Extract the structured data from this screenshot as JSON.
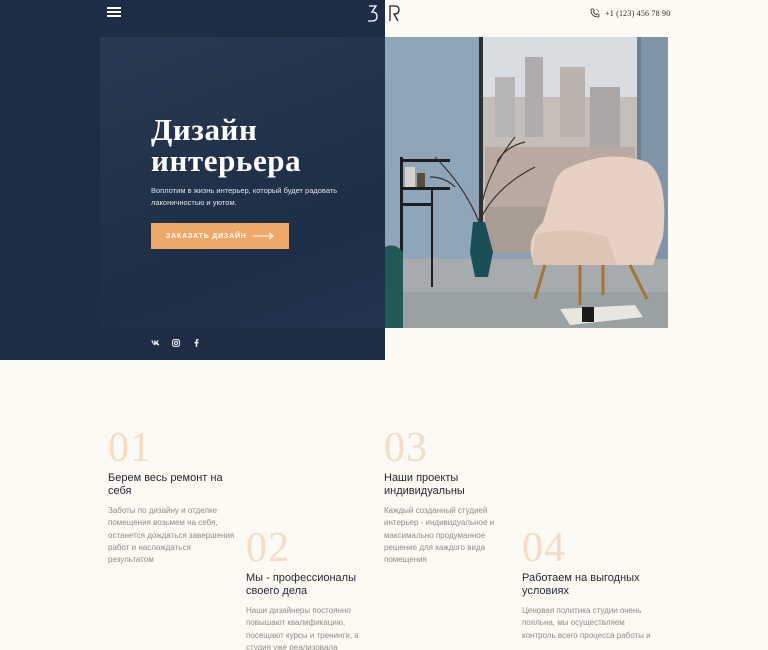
{
  "header": {
    "menu_icon": "hamburger-menu-icon",
    "logo_letters": "BR",
    "phone": "+1 (123) 456 78 90",
    "phone_icon": "phone-icon"
  },
  "hero": {
    "title_line1": "Дизайн",
    "title_line2": "интерьера",
    "subtitle": "Воплотим в жизнь интерьер, который будет радовать лаконичностью и уютом.",
    "cta_label": "Заказать дизайн",
    "cta_icon": "long-arrow-right-icon",
    "social": [
      {
        "name": "vk-icon"
      },
      {
        "name": "instagram-icon"
      },
      {
        "name": "facebook-icon"
      }
    ]
  },
  "features": [
    {
      "num": "01",
      "title": "Берем весь ремонт на себя",
      "text": "Заботы по дизайну и отделке помещения возьмем на себя, останется дождаться завершения работ и наслаждаться результатом"
    },
    {
      "num": "02",
      "title": "Мы - профессионалы своего дела",
      "text": "Наши дизайнеры постоянно повышают квалификацию, посещают курсы и тренинги, а студия уже реализовала"
    },
    {
      "num": "03",
      "title": "Наши проекты индивидуальны",
      "text": "Каждый созданный студией интерьер - индивидуальное и максимально продуманное решение для каждого вида помещения"
    },
    {
      "num": "04",
      "title": "Работаем на выгодных условиях",
      "text": "Ценовая политика студии очень пояльна, мы осуществляем контроль всего процесса работы и"
    }
  ],
  "colors": {
    "panel": "#1d2d45",
    "accent": "#f0a868",
    "background": "#fdf9f3",
    "number": "#f5dcc4"
  }
}
